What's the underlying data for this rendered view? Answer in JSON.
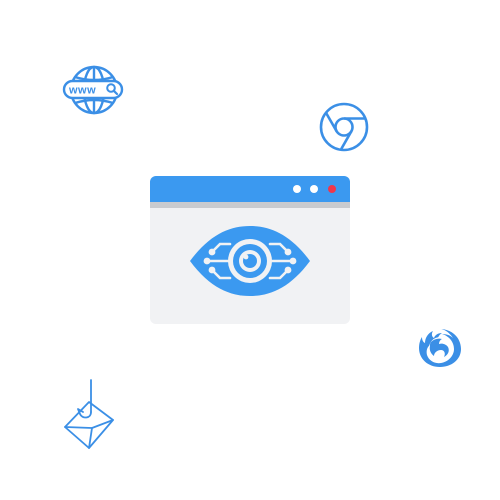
{
  "globe": {
    "icon": "globe-www-search-icon",
    "url_text": "www",
    "color": "#3b8fe6"
  },
  "chrome": {
    "icon": "chrome-browser-icon",
    "color": "#3b8fe6"
  },
  "firefox": {
    "icon": "firefox-browser-icon",
    "color": "#3b8fe6"
  },
  "phishing": {
    "icon": "phishing-hook-envelope-icon",
    "color": "#3b8fe6"
  },
  "browser_window": {
    "titlebar_color": "#3b99f0",
    "body_color": "#f1f2f4",
    "close_dot_color": "#f0364b",
    "content_icon": "surveillance-eye-icon"
  }
}
